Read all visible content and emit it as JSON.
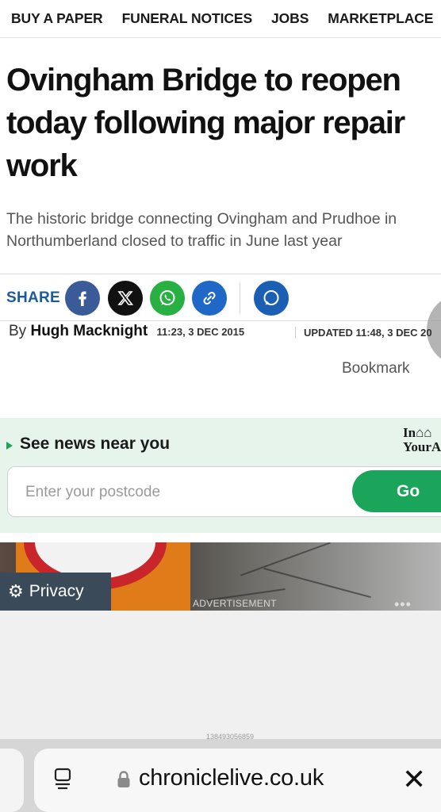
{
  "nav": {
    "items": [
      "BUY A PAPER",
      "FUNERAL NOTICES",
      "JOBS",
      "MARKETPLACE"
    ]
  },
  "article": {
    "headline": "Ovingham Bridge to reopen today following major repair work",
    "standfirst": "The historic bridge connecting Ovingham and Prudhoe in Northumberland closed to traffic in June last year",
    "share_label": "SHARE",
    "byline_prefix": "By",
    "author": "Hugh Macknight",
    "published": "11:23, 3 DEC 2015",
    "updated": "UPDATED  11:48, 3 DEC 20",
    "bookmark": "Bookmark"
  },
  "share": {
    "buttons": [
      {
        "name": "facebook",
        "icon": "facebook-icon",
        "color": "#3b5a98"
      },
      {
        "name": "x",
        "icon": "x-icon",
        "color": "#111111"
      },
      {
        "name": "whatsapp",
        "icon": "whatsapp-icon",
        "color": "#28b043"
      },
      {
        "name": "copy-link",
        "icon": "link-icon",
        "color": "#1f68c7"
      },
      {
        "name": "comments",
        "icon": "comment-icon",
        "color": "#1a5fb4"
      }
    ]
  },
  "near_you": {
    "title": "See news near you",
    "brand_line1": "In⌂⌂",
    "brand_line2": "YourA",
    "postcode_placeholder": "Enter your postcode",
    "go_label": "Go",
    "accent": "#1aa55a",
    "background": "#e6f4ec"
  },
  "ad": {
    "label": "ADVERTISEMENT",
    "id": "138493056859",
    "privacy_label": "Privacy"
  },
  "browser": {
    "url": "chroniclelive.co.uk"
  }
}
